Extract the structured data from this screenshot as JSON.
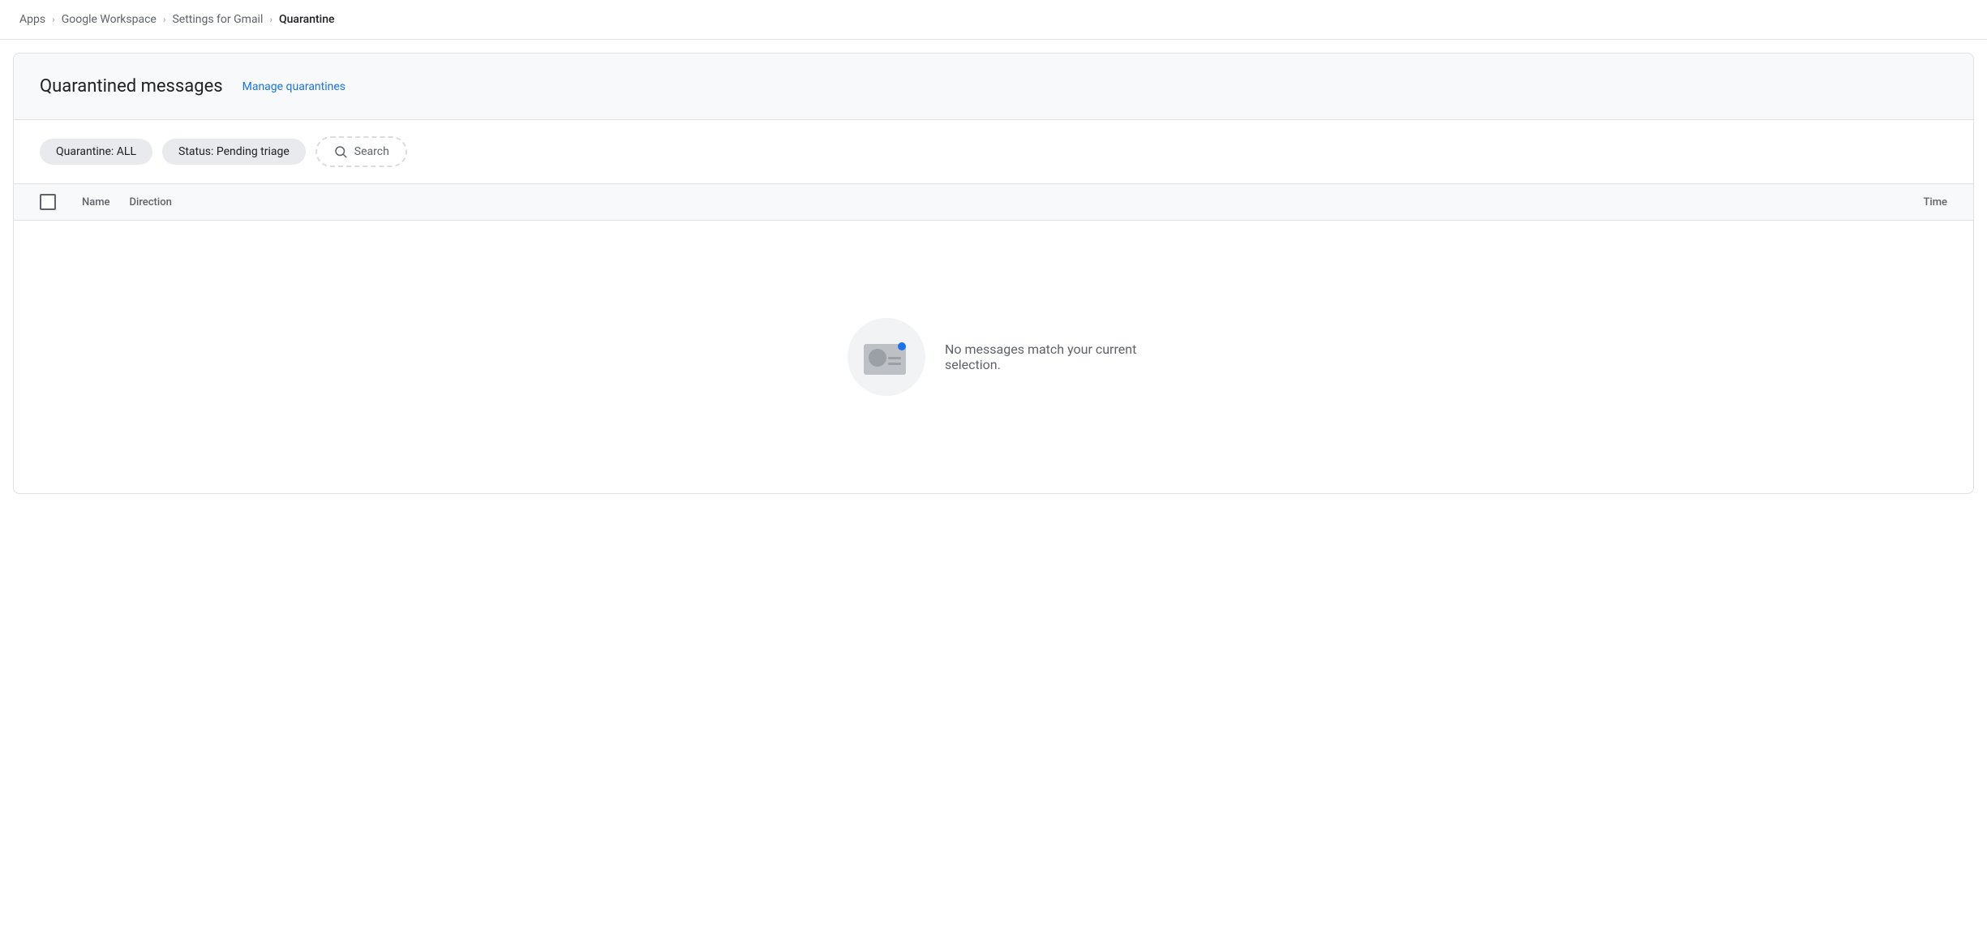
{
  "breadcrumb": {
    "items": [
      {
        "label": "Apps",
        "id": "apps"
      },
      {
        "label": "Google Workspace",
        "id": "google-workspace"
      },
      {
        "label": "Settings for Gmail",
        "id": "settings-for-gmail"
      },
      {
        "label": "Quarantine",
        "id": "quarantine",
        "current": true
      }
    ],
    "separator": "›"
  },
  "header": {
    "title": "Quarantined messages",
    "manage_link_label": "Manage quarantines"
  },
  "filters": {
    "quarantine_chip_label": "Quarantine: ALL",
    "status_chip_label": "Status: Pending triage",
    "search_placeholder": "Search"
  },
  "table": {
    "columns": [
      {
        "label": "Name",
        "id": "name"
      },
      {
        "label": "Direction",
        "id": "direction"
      },
      {
        "label": "Time",
        "id": "time"
      }
    ]
  },
  "empty_state": {
    "message": "No messages match your current selection."
  }
}
